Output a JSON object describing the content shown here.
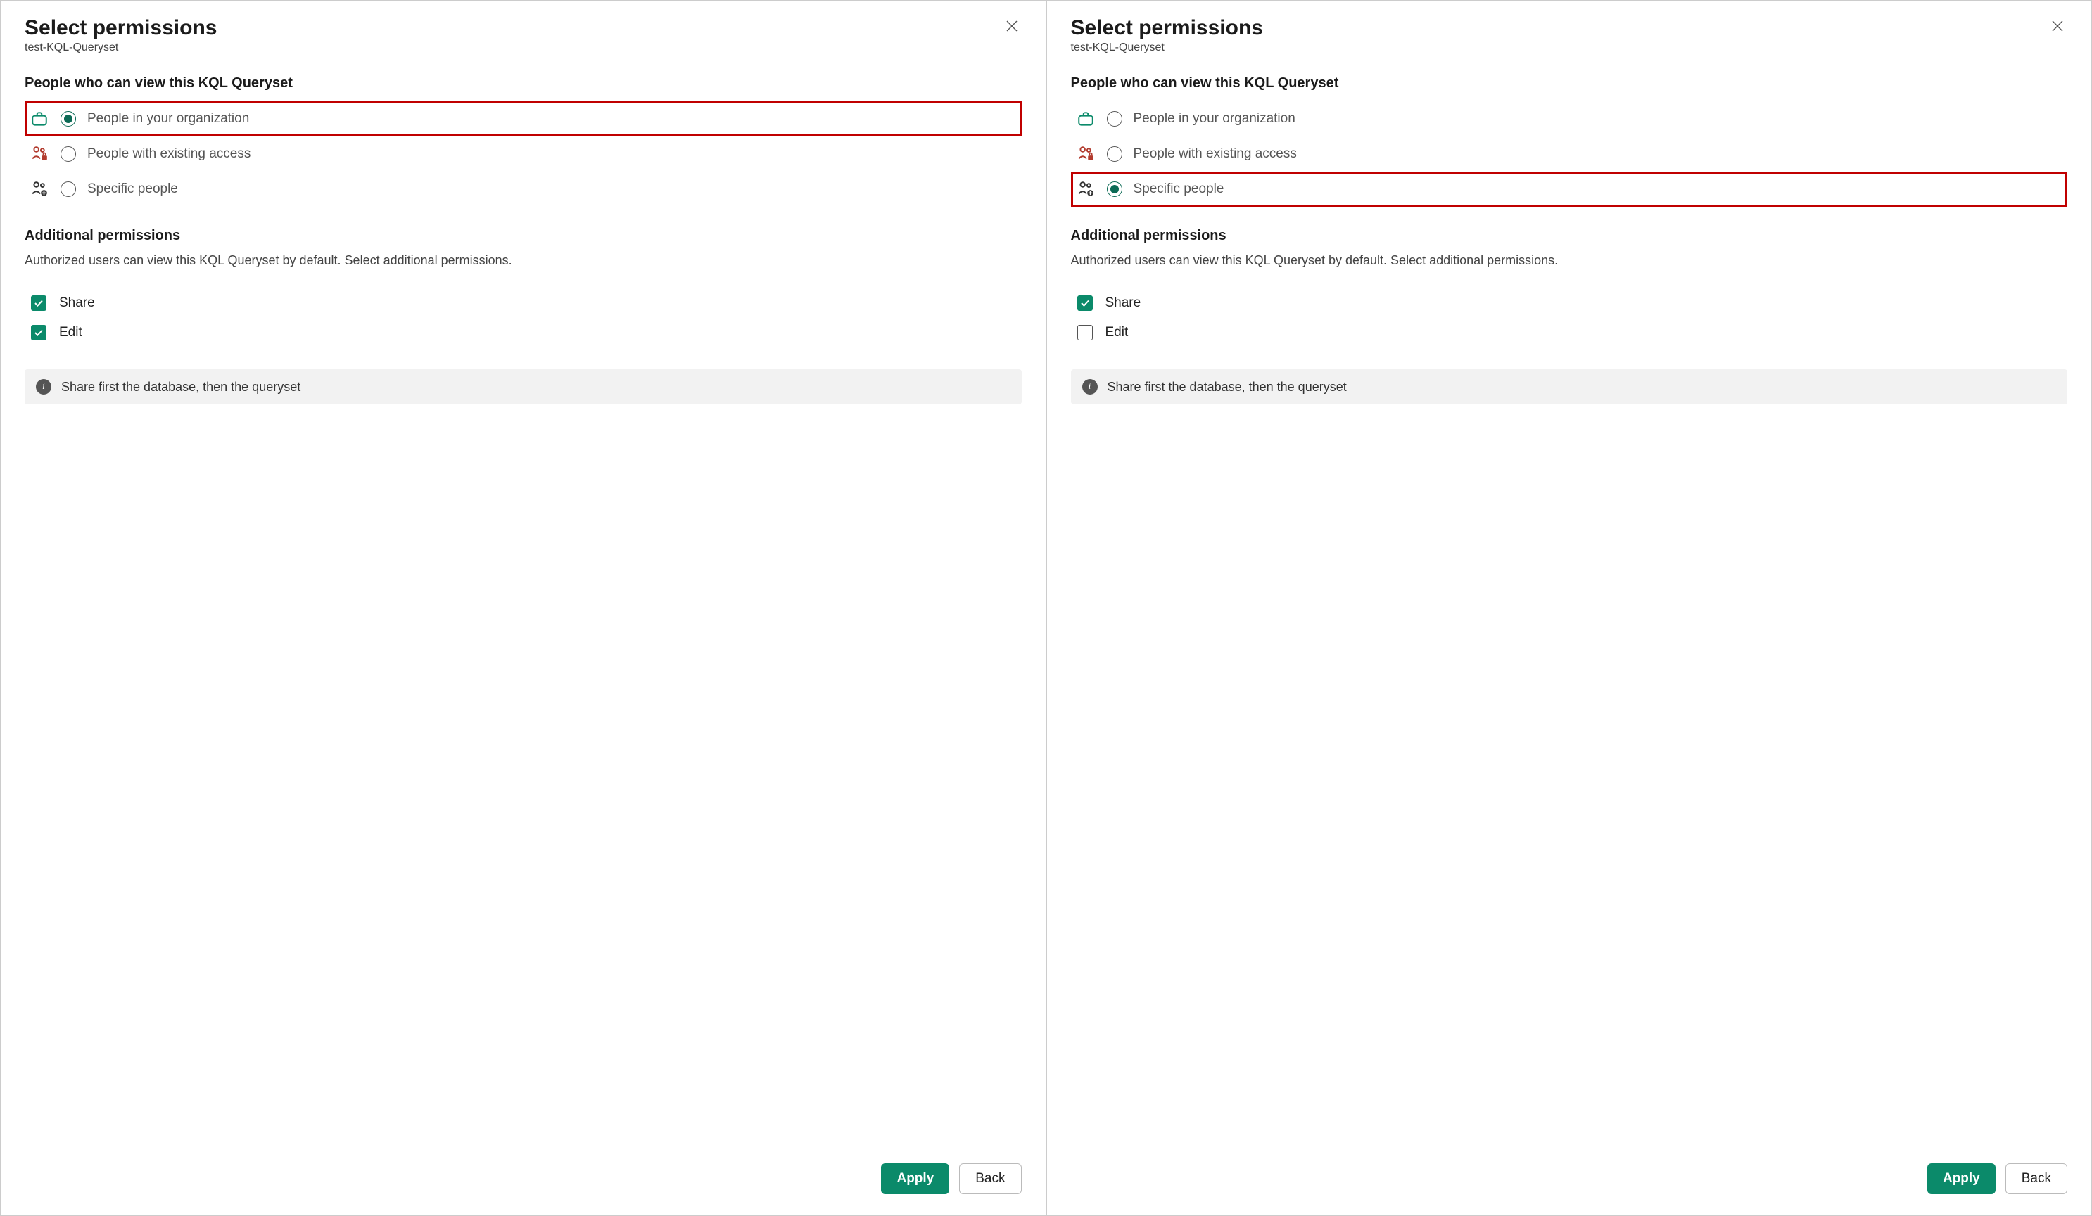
{
  "panels": [
    {
      "title": "Select permissions",
      "subtitle": "test-KQL-Queryset",
      "audience_heading": "People who can view this KQL Queryset",
      "options": [
        {
          "label": "People in your organization",
          "selected": true,
          "highlight": true
        },
        {
          "label": "People with existing access",
          "selected": false,
          "highlight": false
        },
        {
          "label": "Specific people",
          "selected": false,
          "highlight": false
        }
      ],
      "additional_heading": "Additional permissions",
      "additional_desc": "Authorized users can view this KQL Queryset by default. Select additional permissions.",
      "perms_highlight": true,
      "perms": [
        {
          "label": "Share",
          "checked": true
        },
        {
          "label": "Edit",
          "checked": true
        }
      ],
      "info_text": "Share first the database, then the queryset",
      "apply_label": "Apply",
      "back_label": "Back"
    },
    {
      "title": "Select permissions",
      "subtitle": "test-KQL-Queryset",
      "audience_heading": "People who can view this KQL Queryset",
      "options": [
        {
          "label": "People in your organization",
          "selected": false,
          "highlight": false
        },
        {
          "label": "People with existing access",
          "selected": false,
          "highlight": false
        },
        {
          "label": "Specific people",
          "selected": true,
          "highlight": true
        }
      ],
      "additional_heading": "Additional permissions",
      "additional_desc": "Authorized users can view this KQL Queryset by default. Select additional permissions.",
      "perms_highlight": true,
      "perms": [
        {
          "label": "Share",
          "checked": true
        },
        {
          "label": "Edit",
          "checked": false
        }
      ],
      "info_text": "Share first the database, then the queryset",
      "apply_label": "Apply",
      "back_label": "Back"
    }
  ]
}
